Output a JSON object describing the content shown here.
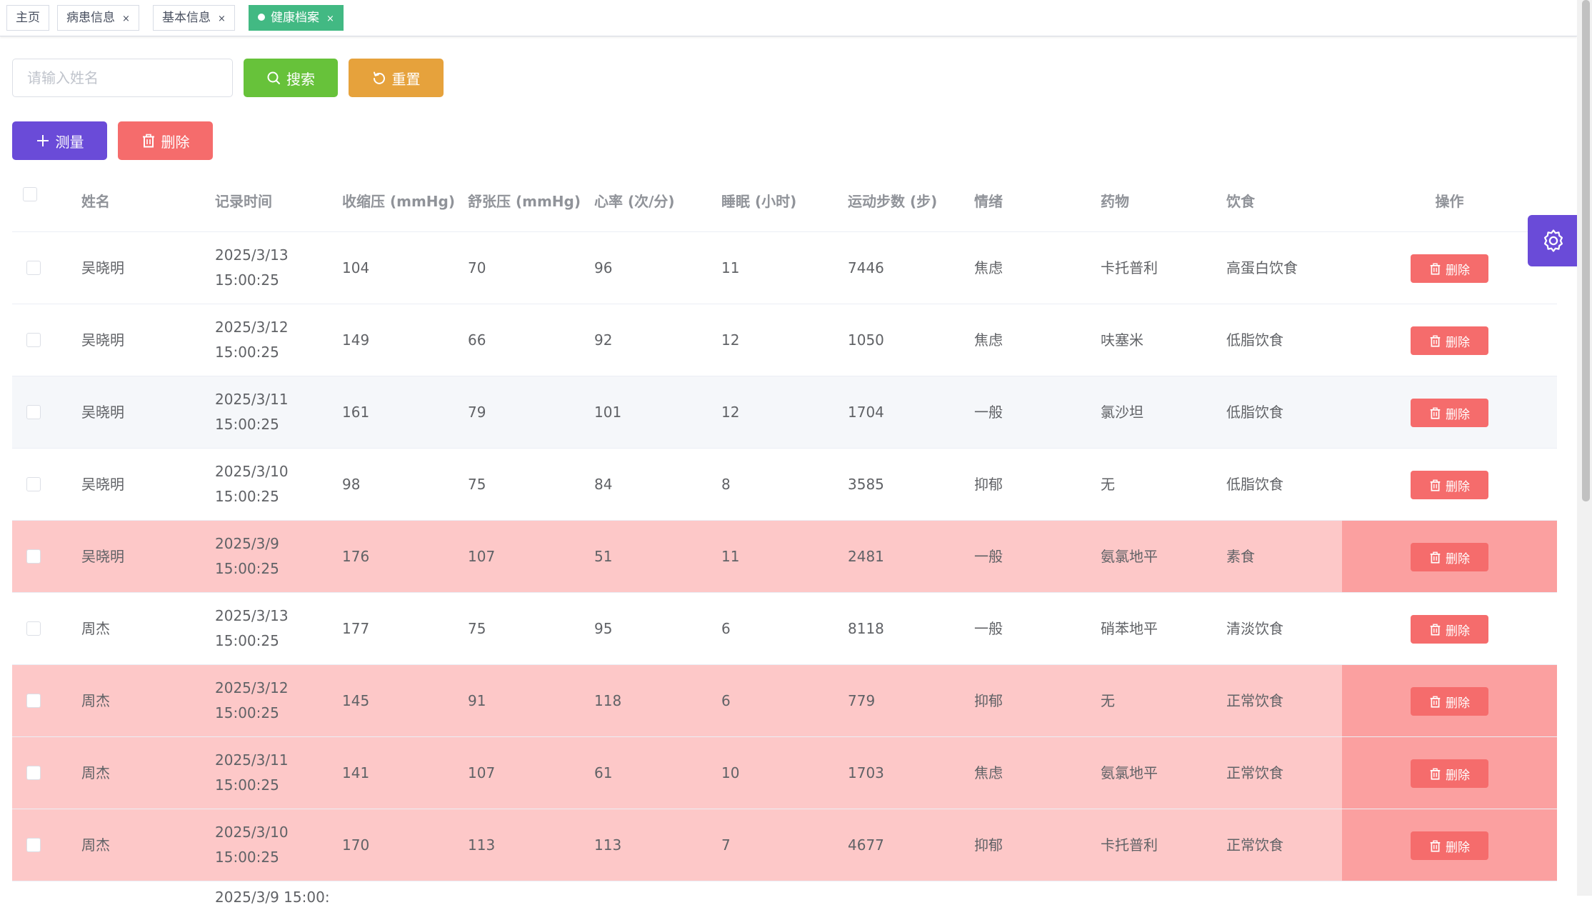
{
  "tags": [
    {
      "label": "主页",
      "closable": false,
      "active": false
    },
    {
      "label": "病患信息",
      "closable": true,
      "active": false
    },
    {
      "label": "基本信息",
      "closable": true,
      "active": false
    },
    {
      "label": "健康档案",
      "closable": true,
      "active": true
    }
  ],
  "toolbar": {
    "search_placeholder": "请输入姓名",
    "search_label": "搜索",
    "reset_label": "重置",
    "measure_label": "测量",
    "delete_label": "删除"
  },
  "colors": {
    "success": "#67c23a",
    "warning": "#e6a23c",
    "primary": "#6a4bd8",
    "danger": "#f56c6c",
    "tag_active": "#42b983",
    "abnormal_row": "#fdc8c8"
  },
  "table": {
    "headers": {
      "name": "姓名",
      "time": "记录时间",
      "systolic": "收缩压 (mmHg)",
      "diastolic": "舒张压 (mmHg)",
      "heart_rate": "心率 (次/分)",
      "sleep": "睡眠 (小时)",
      "steps": "运动步数 (步)",
      "mood": "情绪",
      "medicine": "药物",
      "diet": "饮食",
      "action": "操作"
    },
    "row_delete_label": "删除",
    "rows": [
      {
        "name": "吴晓明",
        "time": "2025/3/13 15:00:25",
        "systolic": "104",
        "diastolic": "70",
        "heart_rate": "96",
        "sleep": "11",
        "steps": "7446",
        "mood": "焦虑",
        "medicine": "卡托普利",
        "diet": "高蛋白饮食",
        "abnormal": false
      },
      {
        "name": "吴晓明",
        "time": "2025/3/12 15:00:25",
        "systolic": "149",
        "diastolic": "66",
        "heart_rate": "92",
        "sleep": "12",
        "steps": "1050",
        "mood": "焦虑",
        "medicine": "呋塞米",
        "diet": "低脂饮食",
        "abnormal": false
      },
      {
        "name": "吴晓明",
        "time": "2025/3/11 15:00:25",
        "systolic": "161",
        "diastolic": "79",
        "heart_rate": "101",
        "sleep": "12",
        "steps": "1704",
        "mood": "一般",
        "medicine": "氯沙坦",
        "diet": "低脂饮食",
        "abnormal": false,
        "hover": true
      },
      {
        "name": "吴晓明",
        "time": "2025/3/10 15:00:25",
        "systolic": "98",
        "diastolic": "75",
        "heart_rate": "84",
        "sleep": "8",
        "steps": "3585",
        "mood": "抑郁",
        "medicine": "无",
        "diet": "低脂饮食",
        "abnormal": false
      },
      {
        "name": "吴晓明",
        "time": "2025/3/9 15:00:25",
        "systolic": "176",
        "diastolic": "107",
        "heart_rate": "51",
        "sleep": "11",
        "steps": "2481",
        "mood": "一般",
        "medicine": "氨氯地平",
        "diet": "素食",
        "abnormal": true
      },
      {
        "name": "周杰",
        "time": "2025/3/13 15:00:25",
        "systolic": "177",
        "diastolic": "75",
        "heart_rate": "95",
        "sleep": "6",
        "steps": "8118",
        "mood": "一般",
        "medicine": "硝苯地平",
        "diet": "清淡饮食",
        "abnormal": false
      },
      {
        "name": "周杰",
        "time": "2025/3/12 15:00:25",
        "systolic": "145",
        "diastolic": "91",
        "heart_rate": "118",
        "sleep": "6",
        "steps": "779",
        "mood": "抑郁",
        "medicine": "无",
        "diet": "正常饮食",
        "abnormal": true
      },
      {
        "name": "周杰",
        "time": "2025/3/11 15:00:25",
        "systolic": "141",
        "diastolic": "107",
        "heart_rate": "61",
        "sleep": "10",
        "steps": "1703",
        "mood": "焦虑",
        "medicine": "氨氯地平",
        "diet": "正常饮食",
        "abnormal": true
      },
      {
        "name": "周杰",
        "time": "2025/3/10 15:00:25",
        "systolic": "170",
        "diastolic": "113",
        "heart_rate": "113",
        "sleep": "7",
        "steps": "4677",
        "mood": "抑郁",
        "medicine": "卡托普利",
        "diet": "正常饮食",
        "abnormal": true
      }
    ],
    "clipped_time": "2025/3/9 15:00:"
  }
}
